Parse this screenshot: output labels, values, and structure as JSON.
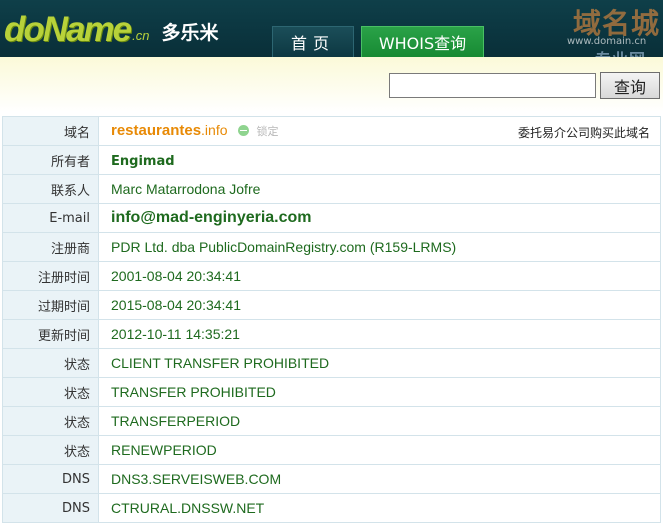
{
  "header": {
    "logo_main": "doName",
    "logo_suffix": ".cn",
    "logo_cn": "多乐米",
    "tabs": [
      {
        "label": "首页",
        "active": false
      },
      {
        "label": "WHOIS查询",
        "active": true
      }
    ],
    "watermark": {
      "main": "域名城",
      "url": "www.domain.cn",
      "sub": "专业网"
    }
  },
  "search": {
    "value": "",
    "placeholder": "",
    "button_label": "查询"
  },
  "domain": {
    "name": "restaurantes",
    "tld": ".info",
    "lock_status": "锁定",
    "broker_link": "委托易介公司购买此域名"
  },
  "records": [
    {
      "label": "所有者",
      "value": "Engimad"
    },
    {
      "label": "联系人",
      "value": "Marc Matarrodona Jofre"
    },
    {
      "label": "E-mail",
      "value": "info@mad-enginyeria.com"
    },
    {
      "label": "注册商",
      "value": "PDR Ltd. dba PublicDomainRegistry.com (R159-LRMS)"
    },
    {
      "label": "注册时间",
      "value": "2001-08-04 20:34:41"
    },
    {
      "label": "过期时间",
      "value": "2015-08-04 20:34:41"
    },
    {
      "label": "更新时间",
      "value": "2012-10-11 14:35:21"
    },
    {
      "label": "状态",
      "value": "CLIENT TRANSFER PROHIBITED"
    },
    {
      "label": "状态",
      "value": "TRANSFER PROHIBITED"
    },
    {
      "label": "状态",
      "value": "TRANSFERPERIOD"
    },
    {
      "label": "状态",
      "value": "RENEWPERIOD"
    },
    {
      "label": "DNS",
      "value": "DNS3.SERVEISWEB.COM"
    },
    {
      "label": "DNS",
      "value": "CTRURAL.DNSSW.NET"
    }
  ],
  "domain_label": "域名",
  "colors": {
    "header_bg": "#0b3640",
    "logo_green": "#b8d23a",
    "active_tab": "#178a33",
    "value_text": "#1e6a1e",
    "domain_orange": "#e88a06",
    "label_bg": "#eaf3f7"
  }
}
